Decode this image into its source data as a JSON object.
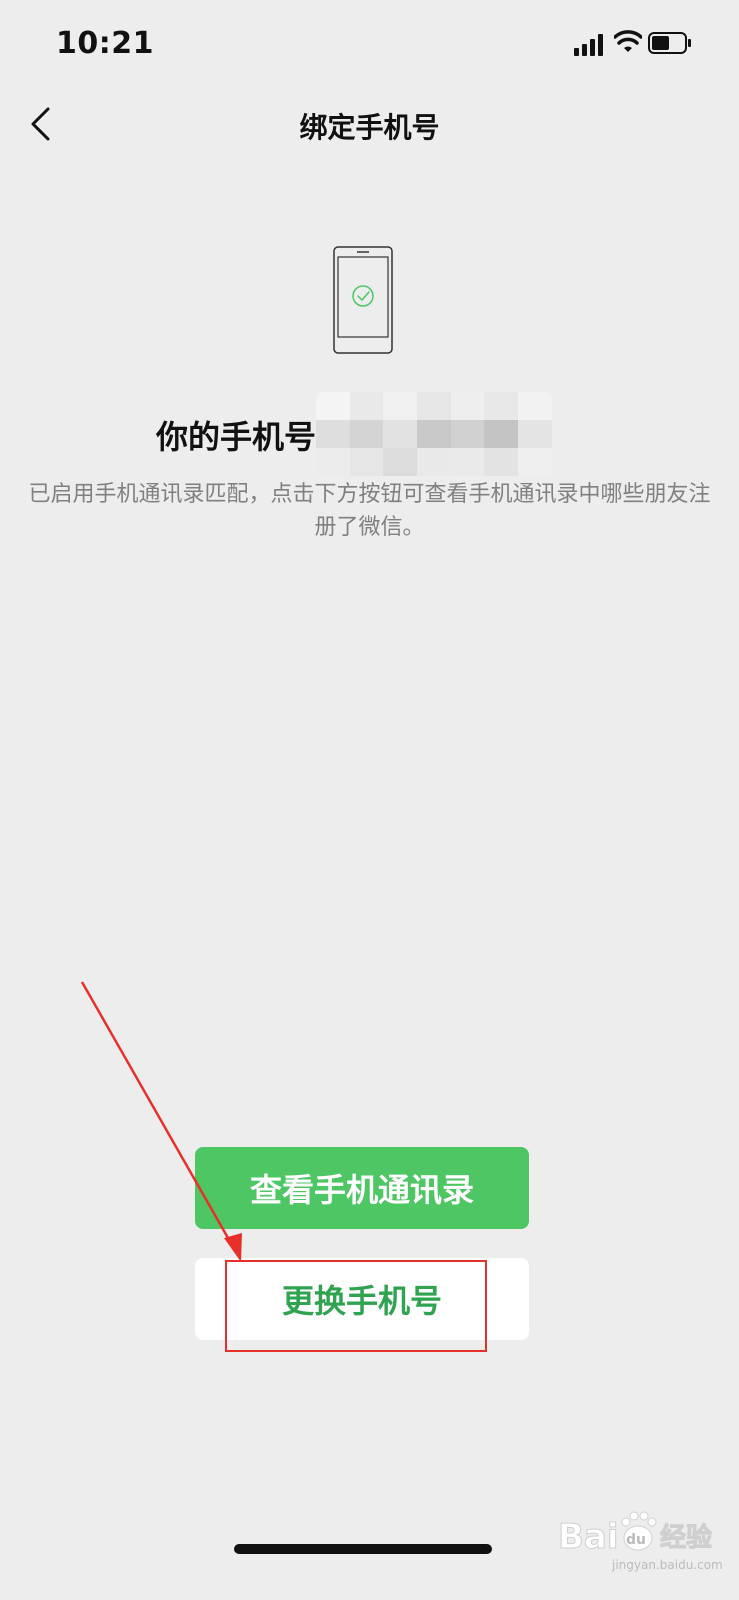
{
  "status_bar": {
    "time": "10:21"
  },
  "nav": {
    "title": "绑定手机号"
  },
  "phone_line": {
    "label": "你的手机号"
  },
  "description": "已启用手机通讯录匹配，点击下方按钮可查看手机通讯录中哪些朋友注册了微信。",
  "buttons": {
    "view_contacts": "查看手机通讯录",
    "change_number": "更换手机号"
  },
  "watermark": {
    "brand": "Bai",
    "paw": "du",
    "cn": "经验",
    "url": "jingyan.baidu.com"
  },
  "colors": {
    "accent_green": "#4dc663",
    "secondary_text_green": "#2fa34f",
    "annotation_red": "#e8302a",
    "background": "#ededed"
  },
  "icons": [
    "signal-icon",
    "wifi-icon",
    "battery-icon",
    "back-chevron-icon",
    "phone-check-icon"
  ]
}
